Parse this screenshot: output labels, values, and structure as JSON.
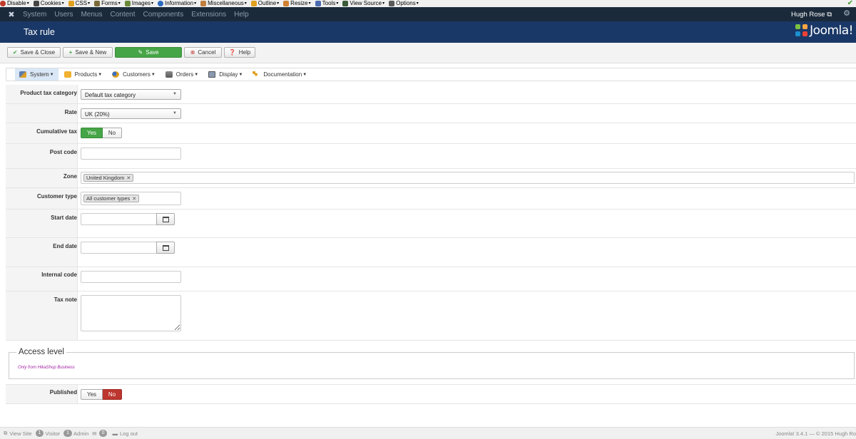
{
  "devbar": {
    "items": [
      {
        "label": "Disable",
        "color": "#c0392b"
      },
      {
        "label": "Cookies",
        "color": "#444444"
      },
      {
        "label": "CSS",
        "color": "#e0a020"
      },
      {
        "label": "Forms",
        "color": "#7a6a3a"
      },
      {
        "label": "Images",
        "color": "#6a8a3a"
      },
      {
        "label": "Information",
        "color": "#2a6ac0"
      },
      {
        "label": "Miscellaneous",
        "color": "#c08040"
      },
      {
        "label": "Outline",
        "color": "#e0a020"
      },
      {
        "label": "Resize",
        "color": "#d08030"
      },
      {
        "label": "Tools",
        "color": "#4a6ab0"
      },
      {
        "label": "View Source",
        "color": "#3a5a3a"
      },
      {
        "label": "Options",
        "color": "#5a5a5a"
      }
    ]
  },
  "topnav": {
    "items": [
      "System",
      "Users",
      "Menus",
      "Content",
      "Components",
      "Extensions",
      "Help"
    ],
    "user": "Hugh Rose"
  },
  "header": {
    "title": "Tax rule",
    "brand": "Joomla!"
  },
  "toolbar": {
    "save_close": "Save & Close",
    "save_new": "Save & New",
    "save": "Save",
    "cancel": "Cancel",
    "help": "Help"
  },
  "submenu": {
    "items": [
      "System",
      "Products",
      "Customers",
      "Orders",
      "Display",
      "Documentation"
    ]
  },
  "form": {
    "product_tax_category": {
      "label": "Product tax category",
      "value": "Default tax category"
    },
    "rate": {
      "label": "Rate",
      "value": "UK (20%)"
    },
    "cumulative_tax": {
      "label": "Cumulative tax",
      "yes": "Yes",
      "no": "No",
      "selected": "Yes"
    },
    "post_code": {
      "label": "Post code",
      "value": ""
    },
    "zone": {
      "label": "Zone",
      "chip": "United Kingdom"
    },
    "customer_type": {
      "label": "Customer type",
      "chip": "All customer types"
    },
    "start_date": {
      "label": "Start date",
      "value": ""
    },
    "end_date": {
      "label": "End date",
      "value": ""
    },
    "internal_code": {
      "label": "Internal code",
      "value": ""
    },
    "tax_note": {
      "label": "Tax note",
      "value": ""
    },
    "access_level": {
      "legend": "Access level",
      "note": "Only from HikaShop Business"
    },
    "published": {
      "label": "Published",
      "yes": "Yes",
      "no": "No",
      "selected": "No"
    }
  },
  "status": {
    "view_site": "View Site",
    "visitor_count": "1",
    "visitor": "Visitor",
    "admin_count": "1",
    "admin": "Admin",
    "messages_count": "0",
    "logout": "Log out",
    "copyright": "Joomla! 3.4.1 — © 2015 Hugh Ro"
  },
  "colors": {
    "header_bg": "#1a3867",
    "topnav_bg": "#1b2a3b",
    "save_green": "#46a546",
    "no_red": "#bd362f"
  }
}
